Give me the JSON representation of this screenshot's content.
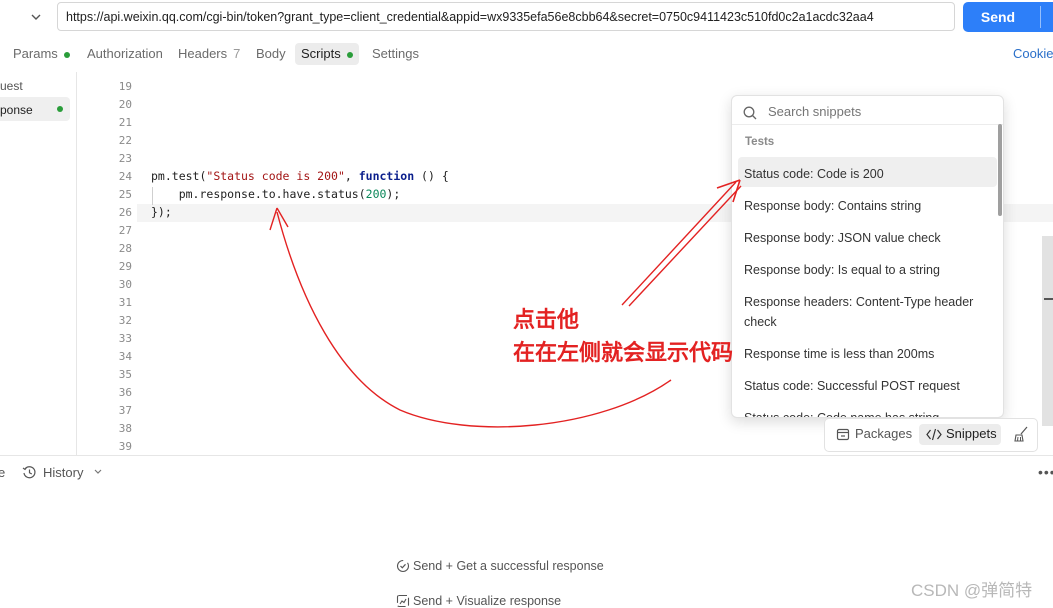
{
  "request": {
    "url": "https://api.weixin.qq.com/cgi-bin/token?grant_type=client_credential&appid=wx9335efa56e8cbb64&secret=0750c9411423c510fd0c2a1acdc32aa4",
    "send_label": "Send"
  },
  "tabs": [
    {
      "label": "Params",
      "dot": true
    },
    {
      "label": "Authorization"
    },
    {
      "label": "Headers",
      "count": "7"
    },
    {
      "label": "Body"
    },
    {
      "label": "Scripts",
      "dot": true,
      "active": true
    },
    {
      "label": "Settings"
    }
  ],
  "cookies_label": "Cookie",
  "sidebar": {
    "items": [
      {
        "label": "uest"
      },
      {
        "label": "ponse",
        "selected": true,
        "dot": true
      }
    ]
  },
  "editor": {
    "line_numbers": [
      "19",
      "20",
      "21",
      "22",
      "23",
      "24",
      "25",
      "26",
      "27",
      "28",
      "29",
      "30",
      "31",
      "32",
      "33",
      "34",
      "35",
      "36",
      "37",
      "38",
      "39"
    ],
    "code": {
      "line24": {
        "prefix": "pm.test(",
        "string": "\"Status code is 200\"",
        "sep": ", ",
        "keyword": "function",
        "suffix": " () {"
      },
      "line25": {
        "indent": "    ",
        "obj": "pm.response.to.have.status(",
        "number": "200",
        "end": ");"
      },
      "line26": "});"
    }
  },
  "snippets": {
    "search_placeholder": "Search snippets",
    "section": "Tests",
    "items": [
      "Status code: Code is 200",
      "Response body: Contains string",
      "Response body: JSON value check",
      "Response body: Is equal to a string",
      "Response headers: Content-Type header check",
      "Response time is less than 200ms",
      "Status code: Successful POST request",
      "Status code: Code name has string"
    ],
    "highlighted_index": 0
  },
  "toolbar": {
    "packages_label": "Packages",
    "snippets_label": "Snippets"
  },
  "bottom": {
    "history_label": "History",
    "more_label": "•••",
    "tips": [
      "Send + Get a successful response",
      "Send + Visualize response"
    ]
  },
  "annotation": {
    "line1": "点击他",
    "line2": "在在左侧就会显示代码",
    "color": "#e32222"
  },
  "watermark": "CSDN @弹简特",
  "colors": {
    "send": "#2d7ff9",
    "status_dot": "#2a9d3a",
    "link": "#2a6fc9"
  }
}
